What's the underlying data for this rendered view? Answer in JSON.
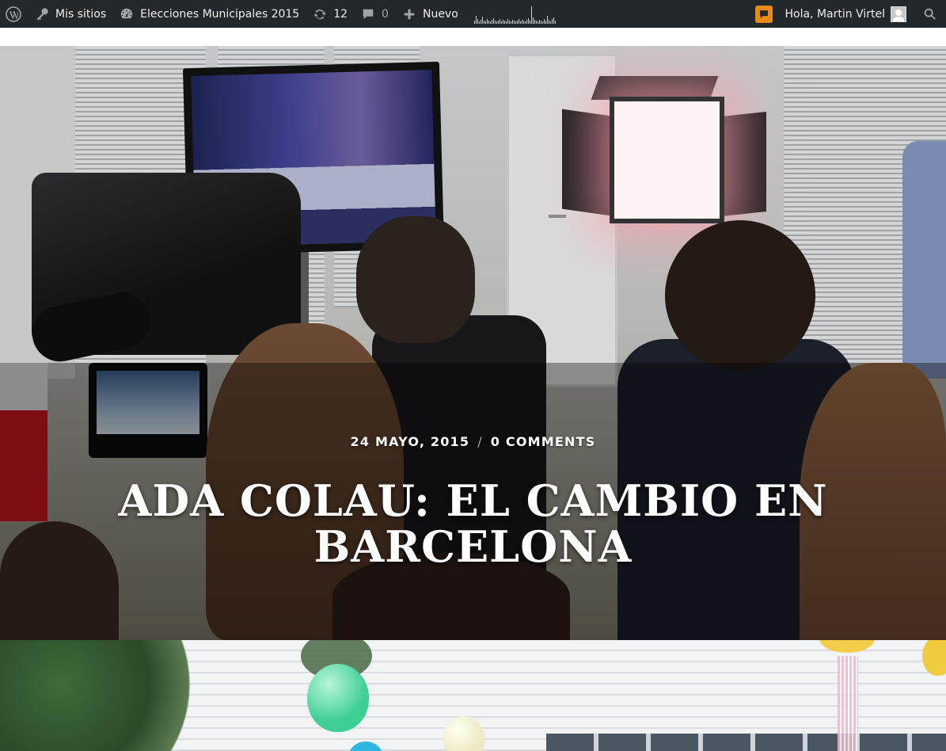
{
  "admin_bar": {
    "logo_icon": "wordpress-icon",
    "my_sites": {
      "icon": "key-icon",
      "label": "Mis sitios"
    },
    "site": {
      "icon": "dashboard-icon",
      "label": "Elecciones Municipales 2015"
    },
    "updates": {
      "icon": "refresh-icon",
      "count": "12"
    },
    "comments": {
      "icon": "comment-icon",
      "count": "0"
    },
    "new": {
      "icon": "plus-icon",
      "label": "Nuevo"
    },
    "stats_icon": "sparkline-icon",
    "notifications_icon": "notification-icon",
    "account": {
      "greeting": "Hola, Martin Virtel"
    },
    "search_icon": "search-icon",
    "colors": {
      "bar": "#23282d",
      "notification": "#e88a18"
    }
  },
  "featured_post": {
    "date": "24 MAYO, 2015",
    "separator": "/",
    "comments": "0 COMMENTS",
    "title": "ADA COLAU: EL CAMBIO EN BARCELONA"
  },
  "next_post": {}
}
